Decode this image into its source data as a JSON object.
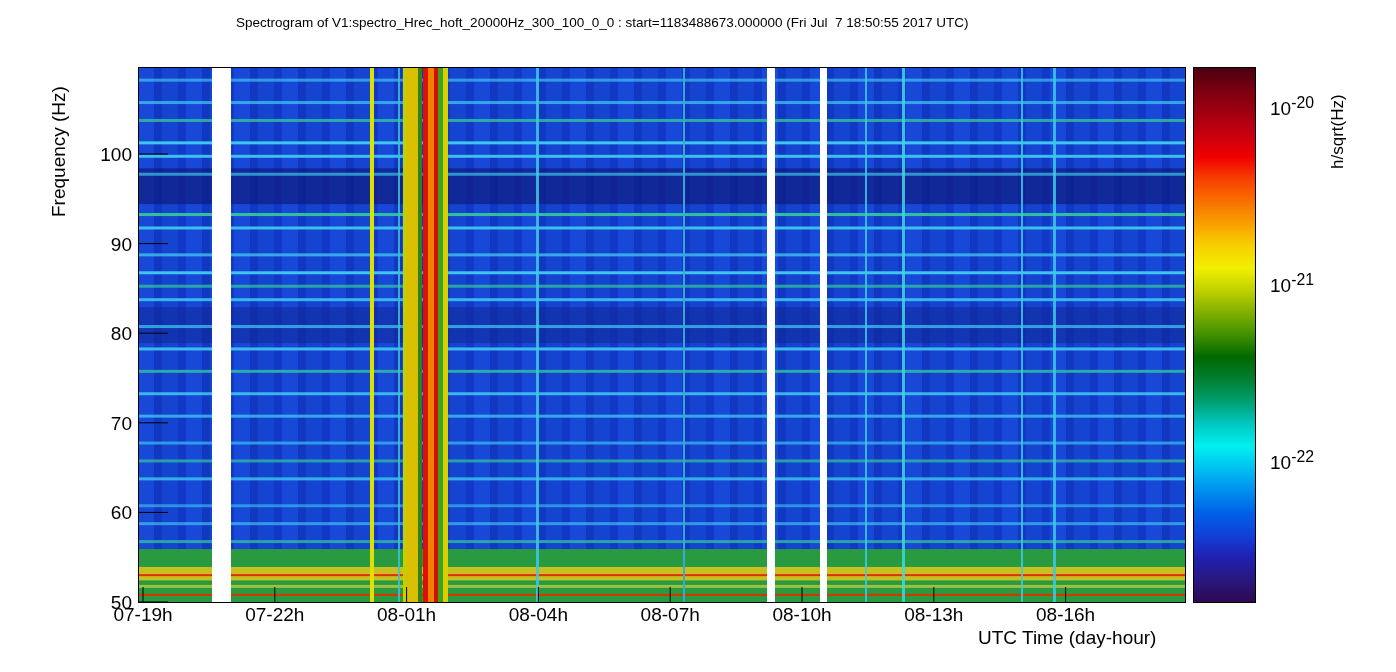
{
  "plot": {
    "title": "Spectrogram of V1:spectro_Hrec_hoft_20000Hz_300_100_0_0 : start=1183488673.000000 (Fri Jul  7 18:50:55 2017 UTC)",
    "ylabel": "Frequency (Hz)",
    "xlabel": "UTC Time (day-hour)",
    "yticks": [
      "100",
      "90",
      "80",
      "70",
      "60",
      "50"
    ],
    "xticks": [
      "07-19h",
      "07-22h",
      "08-01h",
      "08-04h",
      "08-07h",
      "08-10h",
      "08-13h",
      "08-16h"
    ],
    "colorbar": {
      "label": "h/sqrt(Hz)",
      "ticks": [
        "10$^{-20}$",
        "10$^{-21}$",
        "10$^{-22}$"
      ]
    }
  }
}
